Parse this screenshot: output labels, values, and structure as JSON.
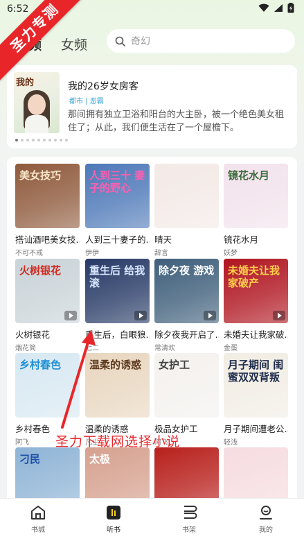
{
  "status_bar": {
    "time": "6:52"
  },
  "watermark": {
    "ribbon_text": "圣力专测",
    "caption": "圣力下载网选择小说"
  },
  "header": {
    "tabs": [
      {
        "label": "男频"
      },
      {
        "label": "女频"
      }
    ],
    "search_placeholder": "奇幻"
  },
  "banner": {
    "cover_text": "我的",
    "title": "我的26岁女房客",
    "tags": "都市 | 恶霸",
    "description": "那间拥有独立卫浴和阳台的大主卧，被一个绝色美女租住了；从此，我们便生活在了一个屋檐下。",
    "dots": 10,
    "active_dot": 0
  },
  "books": [
    {
      "title": "搭讪酒吧美女技...",
      "author": "不可不戒",
      "cover_text": "美女技巧",
      "bg": "#8f5a3c",
      "fg": "#f6e6c8"
    },
    {
      "title": "人到三十妻子的...",
      "author": "伊伊",
      "cover_text": "人到三十 妻子的野心",
      "bg": "#4d78b8",
      "fg": "#ff5fb0"
    },
    {
      "title": "晴天",
      "author": "辞言",
      "cover_text": "",
      "bg": "#f3e9e6",
      "fg": "#c21f2a"
    },
    {
      "title": "镜花水月",
      "author": "妖梦",
      "cover_text": "镜花水月",
      "bg": "#f2e2ec",
      "fg": "#3a6b3a"
    },
    {
      "title": "火树银花",
      "author": "烟花简",
      "cover_text": "火树银花",
      "bg": "#c9d3d8",
      "fg": "#d32a1f"
    },
    {
      "title": "重生后，白眼狼...",
      "author": "七二",
      "cover_text": "重生后 给我滚",
      "bg": "#273a66",
      "fg": "#d7e6ff"
    },
    {
      "title": "除夕夜我开启了...",
      "author": "常清欢",
      "cover_text": "除夕夜 游戏",
      "bg": "#3f5f7b",
      "fg": "#ffffff"
    },
    {
      "title": "未婚夫让我家破...",
      "author": "金蛋",
      "cover_text": "未婚夫让我家破产",
      "bg": "#b01520",
      "fg": "#ffd04a"
    },
    {
      "title": "乡村春色",
      "author": "阿飞",
      "cover_text": "乡村春色",
      "bg": "#d7e8f2",
      "fg": "#1f8fd4"
    },
    {
      "title": "温柔的诱惑",
      "author": "凡尘",
      "cover_text": "温柔的诱惑",
      "bg": "#e8d6bf",
      "fg": "#5c3a1e"
    },
    {
      "title": "极品女护工",
      "author": "阿飞",
      "cover_text": "女护工",
      "bg": "#f4f1ee",
      "fg": "#444444"
    },
    {
      "title": "月子期间遭老公...",
      "author": "轻浅",
      "cover_text": "月子期间 闺蜜双双背叛",
      "bg": "#f1ede4",
      "fg": "#1d2b4a"
    },
    {
      "title": "",
      "author": "",
      "cover_text": "刁民",
      "bg": "#8fb4d6",
      "fg": "#1c4fa6"
    },
    {
      "title": "",
      "author": "",
      "cover_text": "太极",
      "bg": "#d6a18f",
      "fg": "#ffffff"
    },
    {
      "title": "",
      "author": "",
      "cover_text": "",
      "bg": "#b8201c",
      "fg": "#f6c04b"
    },
    {
      "title": "",
      "author": "",
      "cover_text": "",
      "bg": "#f6dce0",
      "fg": "#c43a5a"
    }
  ],
  "bottom_nav": [
    {
      "label": "书城",
      "icon": "home-icon",
      "active": false
    },
    {
      "label": "听书",
      "icon": "audio-book-icon",
      "active": true
    },
    {
      "label": "书架",
      "icon": "bookshelf-icon",
      "active": false
    },
    {
      "label": "我的",
      "icon": "profile-icon",
      "active": false
    }
  ],
  "colors": {
    "accent": "#f6d21e",
    "watermark": "#e8262a",
    "tag": "#3ba3d8"
  }
}
